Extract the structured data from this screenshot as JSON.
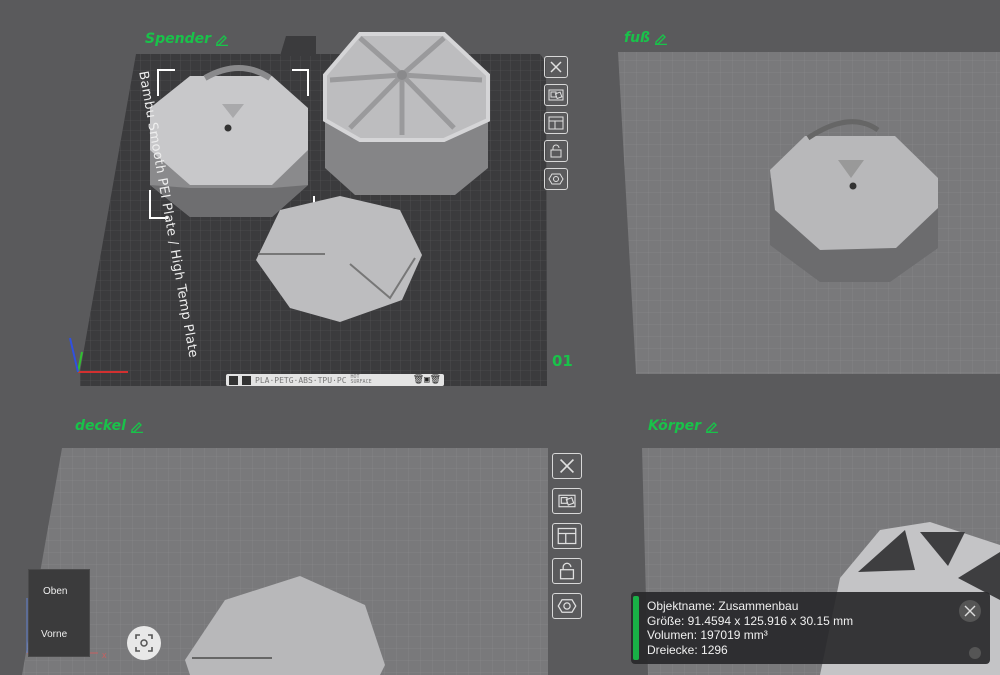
{
  "plates": [
    {
      "title": "Spender"
    },
    {
      "title": "fuß"
    },
    {
      "title": "deckel"
    },
    {
      "title": "Körper"
    }
  ],
  "active_plate": {
    "number": "01",
    "bed_text": "Bambu Smooth PEI Plate / High Temp Plate",
    "filament_label": "PLA·PETG·ABS·TPU·PC",
    "filament_sub1": "HOT",
    "filament_sub2": "SURFACE"
  },
  "plate_toolbar_icons": [
    "close-icon",
    "arrange-icon",
    "layout-icon",
    "lock-icon",
    "settings-icon"
  ],
  "view_cube": {
    "top_label": "Oben",
    "front_label": "Vorne",
    "axis_x": "x"
  },
  "object_info": {
    "name_line": "Objektname: Zusammenbau",
    "size_line": "Größe: 91.4594 x 125.916 x 30.15 mm",
    "volume_line": "Volumen: 197019 mm³",
    "triangles_line": "Dreiecke: 1296"
  },
  "colors": {
    "accent": "#19c24a",
    "background": "#5a5a5c",
    "active_bed": "#3c3c3e",
    "inactive_bed": "#7a7a7c"
  }
}
